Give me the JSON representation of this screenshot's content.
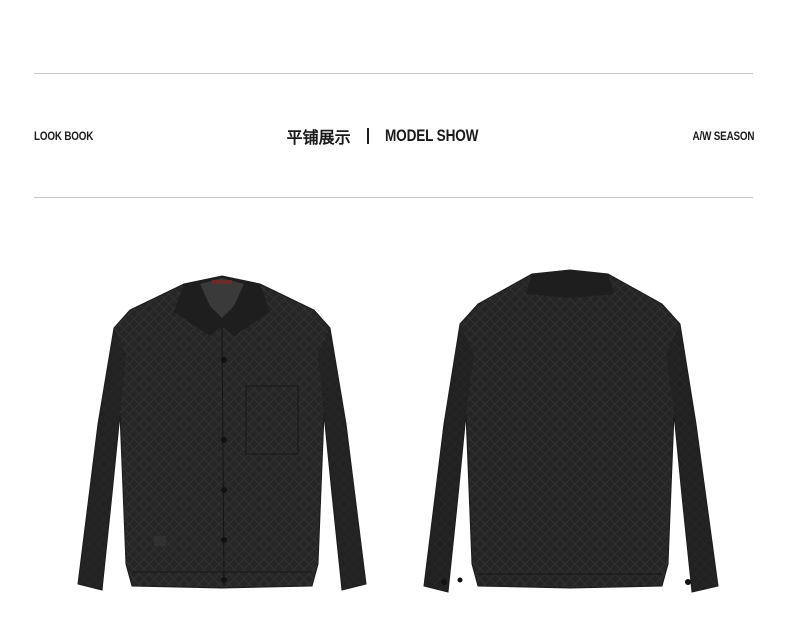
{
  "header": {
    "left_label": "LOOK BOOK",
    "title_cn": "平铺展示",
    "title_en": "MODEL SHOW",
    "right_label": "A/W SEASON"
  },
  "images": [
    {
      "name": "front-view",
      "description_icon": "jacket-front-icon"
    },
    {
      "name": "back-view",
      "description_icon": "jacket-back-icon"
    }
  ],
  "colors": {
    "rule": "#c8c8c8",
    "jacket": "#2a2a2a",
    "jacket_dark": "#1c1c1c",
    "text": "#1a1a1a"
  }
}
